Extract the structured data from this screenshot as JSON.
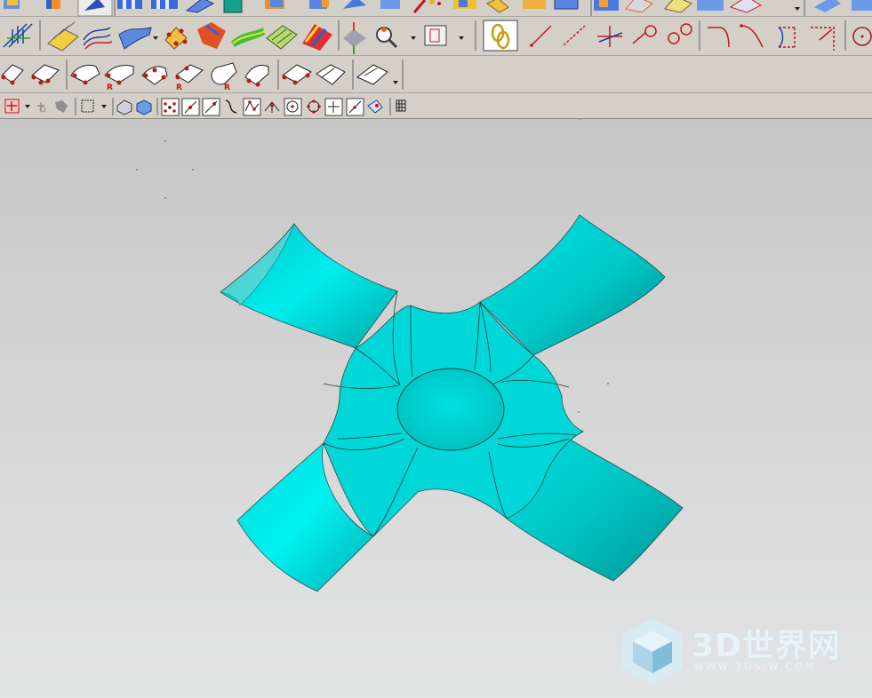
{
  "toolbars": {
    "row1_icons": [
      "surface-icon",
      "block-icon",
      "rotate-view-icon",
      "extrude-icon",
      "revolve-icon",
      "sheet-icon",
      "teal-body-icon",
      "box-icon",
      "block-blue-icon",
      "sweep-icon",
      "face-icon",
      "tools-icon",
      "cylinder-yellow-icon",
      "cylinder-icon",
      "cube-blue-icon",
      "block-blue-icon",
      "shaded-face-icon",
      "plane-icon",
      "cube-icon",
      "pyramid-icon",
      "dropdown-arrow-icon",
      "plane-right-icon"
    ],
    "row2_icons": [
      "section-analysis-icon",
      "surface-grid-icon",
      "curves-icon",
      "ribbon-surface-icon",
      "point-set-icon",
      "orange-face-icon",
      "rainbow-surface-icon",
      "zebra-icon",
      "mesh-surface-icon",
      "color-analysis-icon",
      "deviation-icon",
      "magnifier-icon",
      "box-gauge-icon",
      "chain-link-icon",
      "line-icon",
      "dashed-line-icon",
      "cross-line-icon",
      "arc-point-icon",
      "circle-point-icon",
      "curve-red-icon",
      "spline-red-icon",
      "bracket-dashed-icon",
      "corner-dashed-icon",
      "circle-dashed-icon"
    ],
    "row3_icons": [
      "fillet-icon",
      "edge-blend-icon",
      "face-blend-icon",
      "blend-r-icon",
      "soft-blend-icon",
      "blend-r2-icon",
      "cylinder-blend-icon",
      "chamfer-blend-icon",
      "face-trim-icon",
      "surface-trim-icon",
      "sheet-blend-icon"
    ],
    "row4_icons": [
      "snap-point-icon",
      "point-filter-icon",
      "move-icon",
      "select-box-icon",
      "body-select-icon",
      "cube-select-icon",
      "endpoint-icon",
      "midpoint-icon",
      "line-snap-icon",
      "curve-snap-icon",
      "control-point-icon",
      "intersection-icon",
      "center-icon",
      "quadrant-icon",
      "point-on-curve-icon",
      "point-on-face-icon",
      "face-snap-icon",
      "grid-icon"
    ]
  },
  "viewport": {
    "model_color": "#00d9d6",
    "model_name": "cross-pipe-surface"
  },
  "watermark": {
    "title": "3D世界网",
    "url": "WWW.3DSJW.COM"
  }
}
